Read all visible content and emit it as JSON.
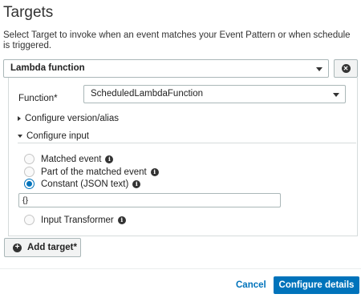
{
  "header": {
    "title": "Targets",
    "description": "Select Target to invoke when an event matches your Event Pattern or when schedule is triggered."
  },
  "target": {
    "type_value": "Lambda function",
    "function_label": "Function*",
    "function_value": "ScheduledLambdaFunction",
    "configure_version_label": "Configure version/alias",
    "configure_input_label": "Configure input",
    "options": [
      {
        "label": "Matched event",
        "selected": false
      },
      {
        "label": "Part of the matched event",
        "selected": false
      },
      {
        "label": "Constant (JSON text)",
        "selected": true
      },
      {
        "label": "Input Transformer",
        "selected": false
      }
    ],
    "constant_value": "{}"
  },
  "actions": {
    "add_target_label": "Add target*",
    "cancel_label": "Cancel",
    "configure_details_label": "Configure details"
  },
  "colors": {
    "accent": "#0073bb"
  }
}
